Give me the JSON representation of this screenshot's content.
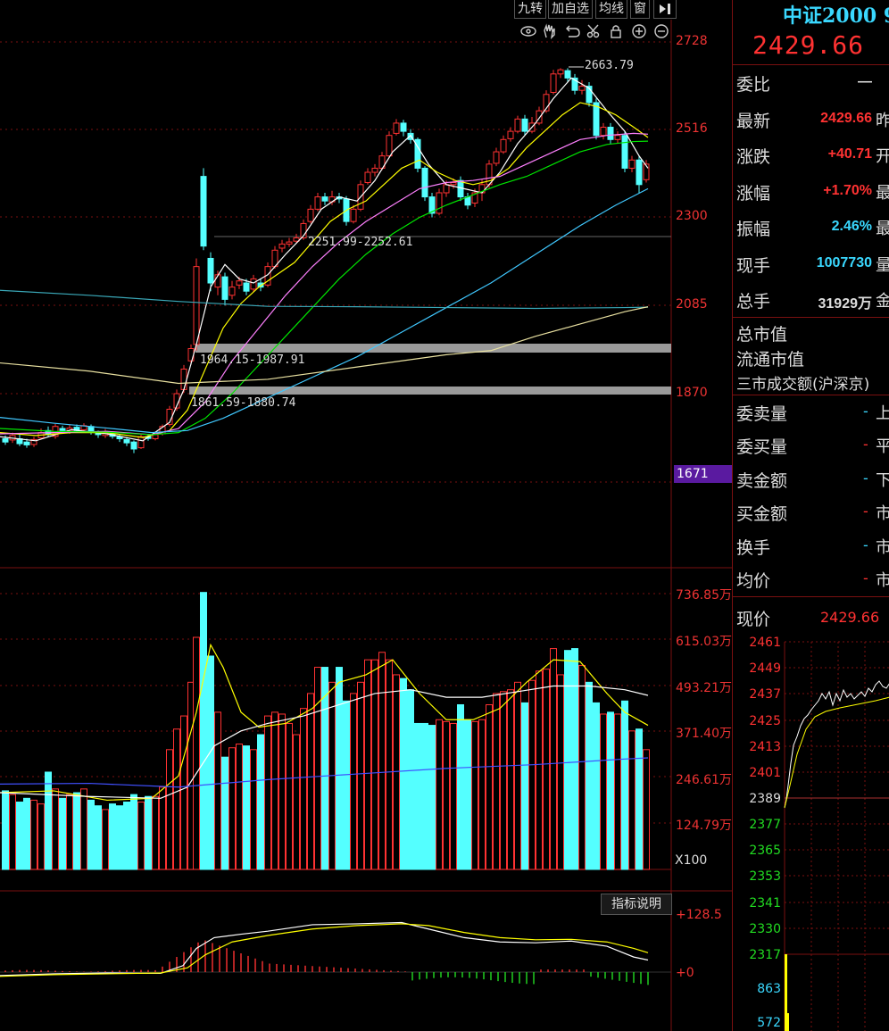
{
  "toolbar": {
    "btn1": "九转",
    "btn2": "加自选",
    "btn3": "均线",
    "btn4": "窗",
    "btn5_icon": "arrow-right-bar-icon",
    "tool_icons": [
      "eye-icon",
      "hand-icon",
      "undo-icon",
      "scissors-icon",
      "lock-icon",
      "zoom-in-icon",
      "zoom-out-icon"
    ]
  },
  "colors": {
    "up": "#ff3232",
    "down": "#54ffff",
    "ma5": "#ffffff",
    "ma10": "#ffff00",
    "ma20": "#ff80ff",
    "ma30": "#00e600",
    "ma60": "#40c8ff",
    "bg": "#000000",
    "grid": "#7a1010"
  },
  "price_axis": [
    "2728",
    "2516",
    "2300",
    "2085",
    "1870",
    "1671"
  ],
  "price_badge": "1671",
  "annotations": {
    "high": "2663.79",
    "gap1": "2251.99-2252.61",
    "gap2": "1964.15-1987.91",
    "gap3": "1861.59-1880.74"
  },
  "volume_axis": [
    "736.85万",
    "615.03万",
    "493.21万",
    "371.40万",
    "246.61万",
    "124.79万"
  ],
  "volume_unit": "X100",
  "indicator_btn": "指标说明",
  "macd_axis": [
    "+128.5",
    "+0"
  ],
  "quote": {
    "name": "中证2000 9",
    "price": "2429.66",
    "rows": [
      {
        "label": "委比",
        "value": "—",
        "suffix": ""
      },
      {
        "label": "最新",
        "value": "2429.66",
        "suffix": "昨"
      },
      {
        "label": "涨跌",
        "value": "+40.71",
        "suffix": "开"
      },
      {
        "label": "涨幅",
        "value": "+1.70%",
        "suffix": "最"
      },
      {
        "label": "振幅",
        "value": "2.46%",
        "suffix": "最"
      },
      {
        "label": "现手",
        "value": "1007730",
        "suffix": "量"
      },
      {
        "label": "总手",
        "value": "31929万",
        "suffix": "金"
      }
    ],
    "market_rows": [
      "总市值",
      "流通市值",
      "三市成交额(沪深京)"
    ],
    "order_rows": [
      {
        "label": "委卖量",
        "suffix": "上"
      },
      {
        "label": "委买量",
        "suffix": "平"
      },
      {
        "label": "卖金额",
        "suffix": "下"
      },
      {
        "label": "买金额",
        "suffix": "市"
      },
      {
        "label": "换手",
        "suffix": "市"
      },
      {
        "label": "均价",
        "suffix": "市"
      }
    ],
    "now_label": "现价",
    "now_value": "2429.66"
  },
  "mini_axis": [
    "2461",
    "2449",
    "2437",
    "2425",
    "2413",
    "2401",
    "2389",
    "2377",
    "2365",
    "2353",
    "2341",
    "2330",
    "2317",
    "863",
    "572"
  ],
  "chart_data": {
    "type": "candlestick",
    "high_label": "2663.79",
    "price_range": [
      1600,
      2750
    ],
    "notes": "daily K-line with MA lines, volume bars and MACD"
  }
}
